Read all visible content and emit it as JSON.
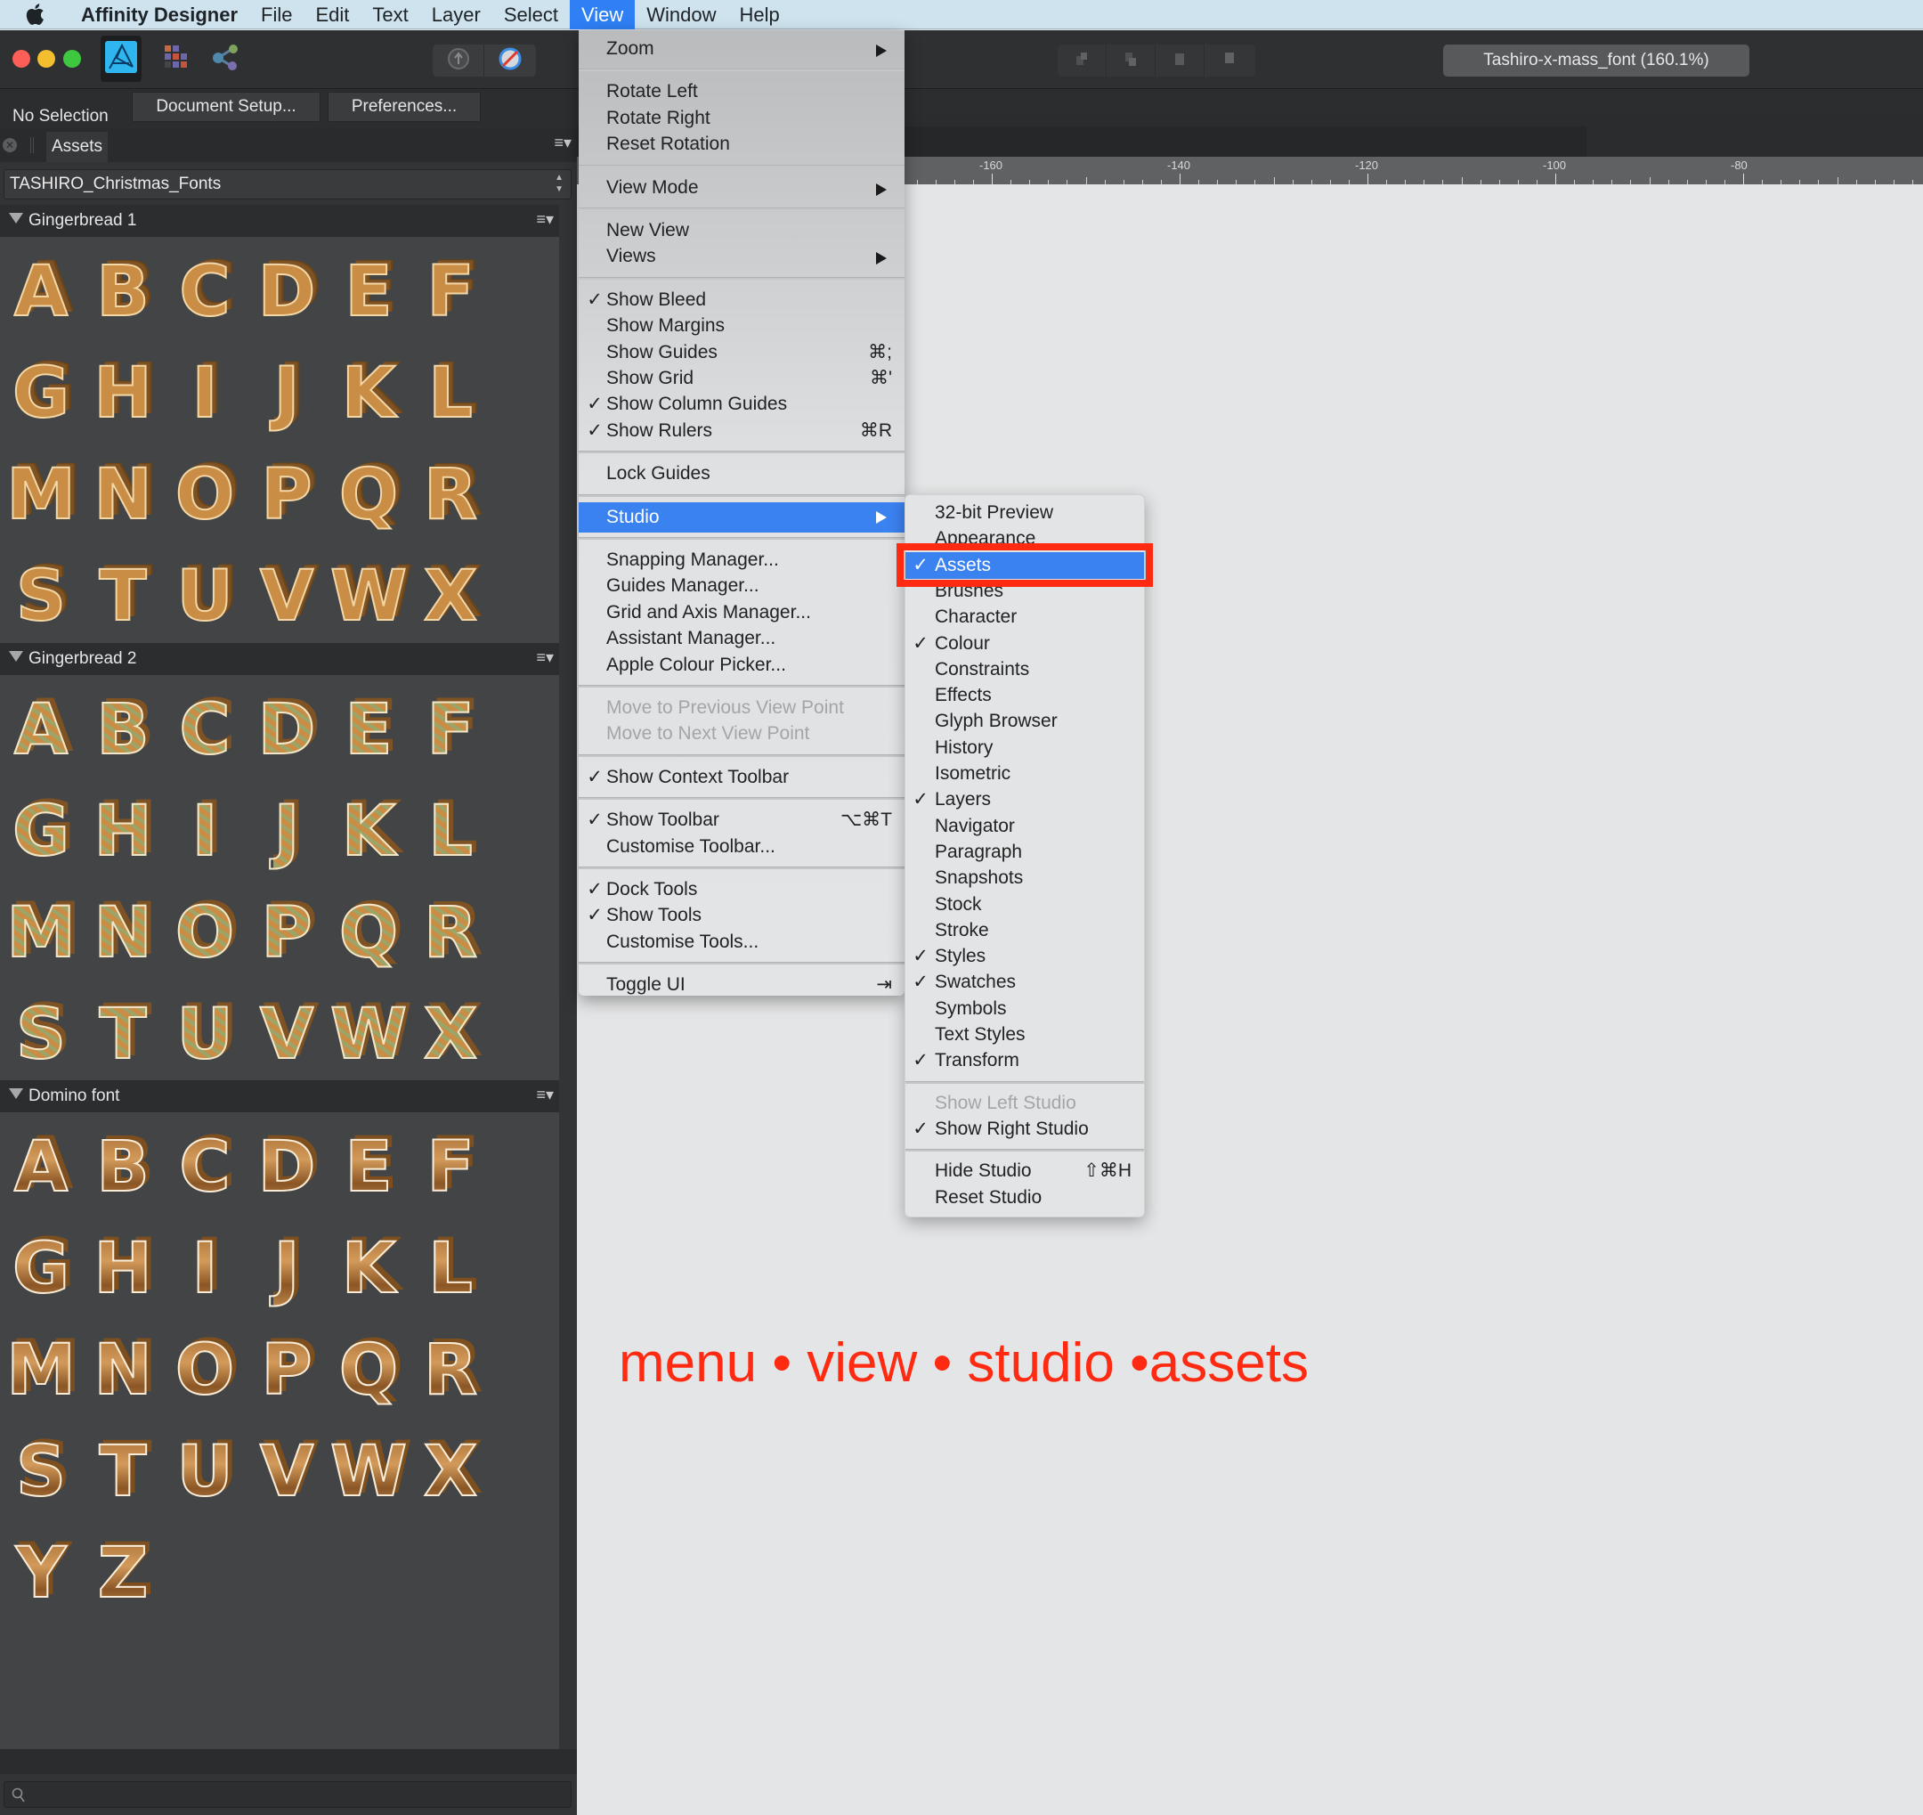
{
  "menubar": {
    "app_name": "Affinity Designer",
    "items": [
      "File",
      "Edit",
      "Text",
      "Layer",
      "Select",
      "View",
      "Window",
      "Help"
    ],
    "active": "View"
  },
  "toolbar": {
    "document_title": "Tashiro-x-mass_font (160.1%)"
  },
  "context_toolbar": {
    "selection_status": "No Selection",
    "document_setup_label": "Document Setup...",
    "preferences_label": "Preferences..."
  },
  "studio": {
    "tab_label": "Assets",
    "category": "TASHIRO_Christmas_Fonts",
    "subcategories": [
      {
        "name": "Gingerbread 1",
        "glyphs": [
          "A",
          "B",
          "C",
          "D",
          "E",
          "F",
          "G",
          "H",
          "I",
          "J",
          "K",
          "L",
          "M",
          "N",
          "O",
          "P",
          "Q",
          "R",
          "S",
          "T",
          "U",
          "V",
          "W",
          "X"
        ]
      },
      {
        "name": "Gingerbread 2",
        "glyphs": [
          "A",
          "B",
          "C",
          "D",
          "E",
          "F",
          "G",
          "H",
          "I",
          "J",
          "K",
          "L",
          "M",
          "N",
          "O",
          "P",
          "Q",
          "R",
          "S",
          "T",
          "U",
          "V",
          "W",
          "X"
        ]
      },
      {
        "name": "Domino font",
        "glyphs": [
          "A",
          "B",
          "C",
          "D",
          "E",
          "F",
          "G",
          "H",
          "I",
          "J",
          "K",
          "L",
          "M",
          "N",
          "O",
          "P",
          "Q",
          "R",
          "S",
          "T",
          "U",
          "V",
          "W",
          "X",
          "Y",
          "Z"
        ]
      }
    ],
    "search_placeholder": ""
  },
  "ruler": {
    "labels": [
      "-160",
      "-140",
      "-120",
      "-100",
      "-80"
    ]
  },
  "view_menu": {
    "items": [
      {
        "label": "Zoom",
        "submenu": true
      },
      {
        "sep": true
      },
      {
        "label": "Rotate Left"
      },
      {
        "label": "Rotate Right"
      },
      {
        "label": "Reset Rotation"
      },
      {
        "sep": true
      },
      {
        "label": "View Mode",
        "submenu": true
      },
      {
        "sep": true
      },
      {
        "label": "New View"
      },
      {
        "label": "Views",
        "submenu": true
      },
      {
        "sep": true
      },
      {
        "label": "Show Bleed",
        "checked": true
      },
      {
        "label": "Show Margins"
      },
      {
        "label": "Show Guides",
        "shortcut": "⌘;"
      },
      {
        "label": "Show Grid",
        "shortcut": "⌘'"
      },
      {
        "label": "Show Column Guides",
        "checked": true
      },
      {
        "label": "Show Rulers",
        "checked": true,
        "shortcut": "⌘R"
      },
      {
        "sep": true
      },
      {
        "label": "Lock Guides"
      },
      {
        "sep": true
      },
      {
        "label": "Studio",
        "submenu": true,
        "highlighted": true
      },
      {
        "sep": true
      },
      {
        "label": "Snapping Manager..."
      },
      {
        "label": "Guides Manager..."
      },
      {
        "label": "Grid and Axis Manager..."
      },
      {
        "label": "Assistant Manager..."
      },
      {
        "label": "Apple Colour Picker..."
      },
      {
        "sep": true
      },
      {
        "label": "Move to Previous View Point",
        "disabled": true
      },
      {
        "label": "Move to Next View Point",
        "disabled": true
      },
      {
        "sep": true
      },
      {
        "label": "Show Context Toolbar",
        "checked": true
      },
      {
        "sep": true
      },
      {
        "label": "Show Toolbar",
        "checked": true,
        "shortcut": "⌥⌘T"
      },
      {
        "label": "Customise Toolbar..."
      },
      {
        "sep": true
      },
      {
        "label": "Dock Tools",
        "checked": true
      },
      {
        "label": "Show Tools",
        "checked": true
      },
      {
        "label": "Customise Tools..."
      },
      {
        "sep": true
      },
      {
        "label": "Toggle UI",
        "shortcut": "⇥"
      }
    ]
  },
  "studio_menu": {
    "items": [
      {
        "label": "32-bit Preview"
      },
      {
        "label": "Appearance"
      },
      {
        "label": "Assets",
        "checked": true,
        "highlighted": true
      },
      {
        "label": "Brushes"
      },
      {
        "label": "Character"
      },
      {
        "label": "Colour",
        "checked": true
      },
      {
        "label": "Constraints"
      },
      {
        "label": "Effects"
      },
      {
        "label": "Glyph Browser"
      },
      {
        "label": "History"
      },
      {
        "label": "Isometric"
      },
      {
        "label": "Layers",
        "checked": true
      },
      {
        "label": "Navigator"
      },
      {
        "label": "Paragraph"
      },
      {
        "label": "Snapshots"
      },
      {
        "label": "Stock"
      },
      {
        "label": "Stroke"
      },
      {
        "label": "Styles",
        "checked": true
      },
      {
        "label": "Swatches",
        "checked": true
      },
      {
        "label": "Symbols"
      },
      {
        "label": "Text Styles"
      },
      {
        "label": "Transform",
        "checked": true
      },
      {
        "sep": true
      },
      {
        "label": "Show Left Studio",
        "disabled": true
      },
      {
        "label": "Show Right Studio",
        "checked": true
      },
      {
        "sep": true
      },
      {
        "label": "Hide Studio",
        "shortcut": "⇧⌘H"
      },
      {
        "label": "Reset Studio"
      }
    ]
  },
  "annotation": {
    "text": "menu • view • studio •assets",
    "color": "#ff2a12"
  },
  "colors": {
    "menu_highlight": "#3b82f1",
    "callout_red": "#ff2a12",
    "panel_bg": "#333436"
  },
  "check_glyph": "✓"
}
